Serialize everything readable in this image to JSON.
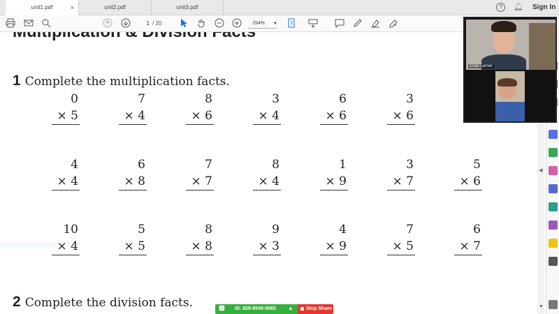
{
  "tabs": [
    {
      "label": "unit1.pdf",
      "close": "×"
    },
    {
      "label": "unit2.pdf"
    },
    {
      "label": "unit3.pdf"
    }
  ],
  "header": {
    "help": "?",
    "signin": "Sign In"
  },
  "toolbar": {
    "page_current": "1",
    "page_total": "/ 20",
    "zoom": "154%"
  },
  "document": {
    "heading": "Multiplication & Division Facts",
    "sections": [
      {
        "number": "1",
        "title": "Complete the multiplication facts."
      },
      {
        "number": "2",
        "title": "Complete the division facts."
      }
    ],
    "problems": [
      [
        {
          "top": "0",
          "bottom": "× 5"
        },
        {
          "top": "7",
          "bottom": "× 4"
        },
        {
          "top": "8",
          "bottom": "× 6"
        },
        {
          "top": "3",
          "bottom": "× 4"
        },
        {
          "top": "6",
          "bottom": "× 6"
        },
        {
          "top": "3",
          "bottom": "× 6"
        }
      ],
      [
        {
          "top": "4",
          "bottom": "× 4"
        },
        {
          "top": "6",
          "bottom": "× 8"
        },
        {
          "top": "7",
          "bottom": "× 7"
        },
        {
          "top": "8",
          "bottom": "× 4"
        },
        {
          "top": "1",
          "bottom": "× 9"
        },
        {
          "top": "3",
          "bottom": "× 7"
        },
        {
          "top": "5",
          "bottom": "× 6"
        }
      ],
      [
        {
          "top": "10",
          "bottom": "× 4"
        },
        {
          "top": "5",
          "bottom": "× 5"
        },
        {
          "top": "8",
          "bottom": "× 8"
        },
        {
          "top": "9",
          "bottom": "× 3"
        },
        {
          "top": "4",
          "bottom": "× 9"
        },
        {
          "top": "7",
          "bottom": "× 5"
        },
        {
          "top": "6",
          "bottom": "× 7"
        }
      ]
    ]
  },
  "video": {
    "participant_name": "Evan Lerner"
  },
  "share_bar": {
    "meeting_id": "ID: 829-8540-0065",
    "stop_label": "Stop Share"
  },
  "colors": {
    "accent": "#1a73e8",
    "share_green": "#36b03c",
    "stop_red": "#e0382e"
  },
  "icons": [
    "print-icon",
    "email-icon",
    "search-icon",
    "page-up-icon",
    "page-down-icon",
    "cursor-icon",
    "hand-icon",
    "zoom-out-icon",
    "zoom-in-icon",
    "fit-page-icon",
    "read-mode-icon",
    "comment-icon",
    "pen-icon",
    "highlight-icon",
    "sign-icon"
  ]
}
